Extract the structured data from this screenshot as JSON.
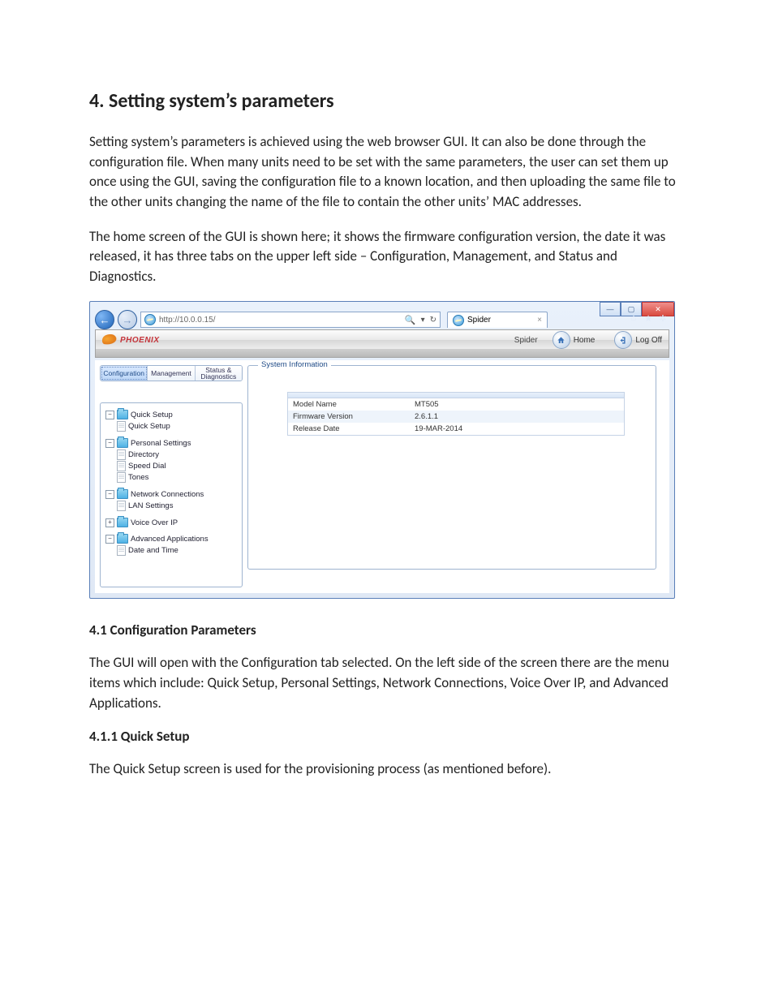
{
  "doc": {
    "heading": "4.  Setting system’s parameters",
    "para1": "Setting system’s parameters is achieved using the web browser GUI. It can also be done through the configuration file. When many units need to be set with the same parameters, the user can set them up once using the GUI, saving the configuration file to a known location, and then uploading the same file to the other units changing the name of the file to contain the other units’ MAC addresses.",
    "para2": "The home screen of the GUI is shown here; it shows the firmware configuration version, the date it was released, it has three tabs on the upper left side – Configuration, Management, and Status and Diagnostics.",
    "sub41": "4.1 Configuration Parameters",
    "para3": "The GUI will open with the Configuration tab selected. On the left side of the screen there are the menu items which include: Quick Setup, Personal Settings, Network Connections, Voice Over IP, and Advanced Applications.",
    "sub411": "4.1.1 Quick Setup",
    "para4": "The Quick Setup screen is used for the provisioning process (as mentioned before)."
  },
  "browser": {
    "url": "http://10.0.0.15/",
    "tab": "Spider",
    "back_glyph": "←",
    "fwd_glyph": "→",
    "refresh_glyph": "↻",
    "dropdown_glyph": "▾",
    "close_tab": "×",
    "win_min": "—",
    "win_max": "▢",
    "win_close": "✕",
    "tool_home": "⌂",
    "tool_star": "★",
    "tool_gear": "✲"
  },
  "app": {
    "logo": "PHOENIX",
    "spider": "Spider",
    "home": "Home",
    "logoff": "Log Off"
  },
  "sidebar": {
    "tabs": {
      "config": "Configuration",
      "mgmt": "Management",
      "status": "Status & Diagnostics"
    },
    "quick_setup_hdr": "Quick Setup",
    "quick_setup_item": "Quick Setup",
    "personal_hdr": "Personal Settings",
    "personal_items": {
      "directory": "Directory",
      "speed_dial": "Speed Dial",
      "tones": "Tones"
    },
    "network_hdr": "Network Connections",
    "network_items": {
      "lan": "LAN Settings"
    },
    "voip_hdr": "Voice Over IP",
    "advanced_hdr": "Advanced Applications",
    "advanced_items": {
      "datetime": "Date and Time"
    },
    "plus": "+",
    "minus": "−"
  },
  "panel": {
    "title": "System Information",
    "rows": {
      "model_k": "Model Name",
      "model_v": "MT505",
      "fw_k": "Firmware Version",
      "fw_v": "2.6.1.1",
      "date_k": "Release Date",
      "date_v": "19-MAR-2014"
    }
  }
}
